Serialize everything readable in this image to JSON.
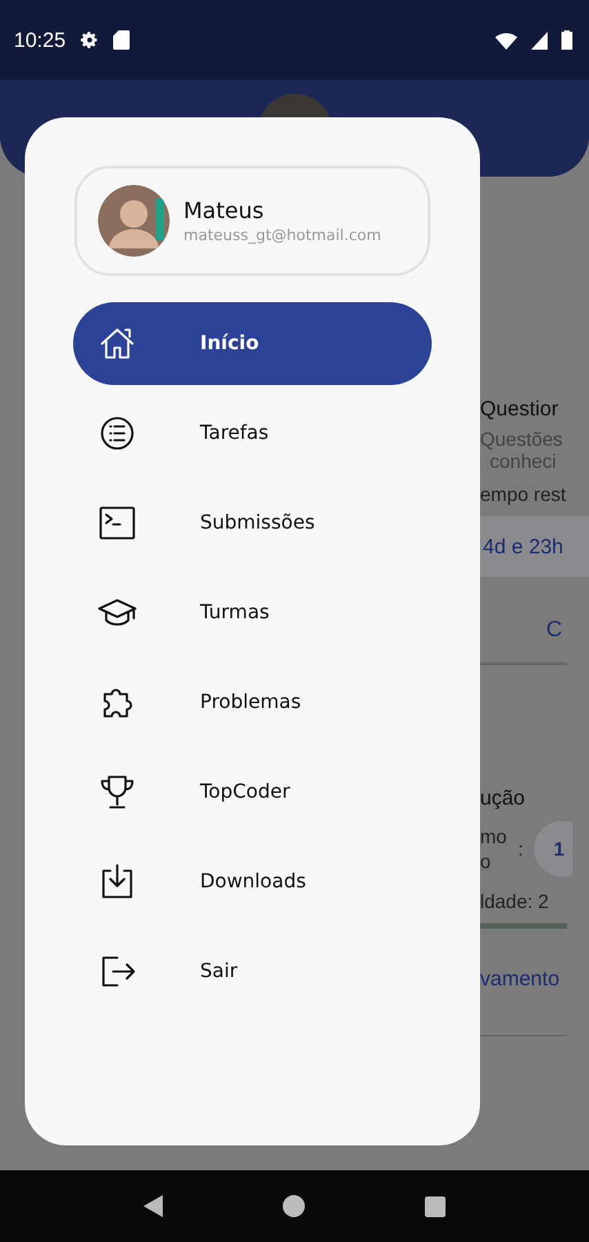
{
  "status_bar": {
    "time": "10:25"
  },
  "profile": {
    "name": "Mateus",
    "email": "mateuss_gt@hotmail.com"
  },
  "menu": [
    {
      "label": "Início",
      "selected": true
    },
    {
      "label": "Tarefas",
      "selected": false
    },
    {
      "label": "Submissões",
      "selected": false
    },
    {
      "label": "Turmas",
      "selected": false
    },
    {
      "label": "Problemas",
      "selected": false
    },
    {
      "label": "TopCoder",
      "selected": false
    },
    {
      "label": "Downloads",
      "selected": false
    },
    {
      "label": "Sair",
      "selected": false
    }
  ],
  "background": {
    "title": "Questior",
    "subtitle_1": "Questões",
    "subtitle_2": "conheci",
    "time_label": "empo rest",
    "time_value": "4d e 23h",
    "link": "C",
    "section": "ução",
    "label_1": "mo",
    "label_2": "o",
    "separator": ":",
    "badge": "1",
    "difficulty": "ldade: 2",
    "action": "vamento"
  }
}
